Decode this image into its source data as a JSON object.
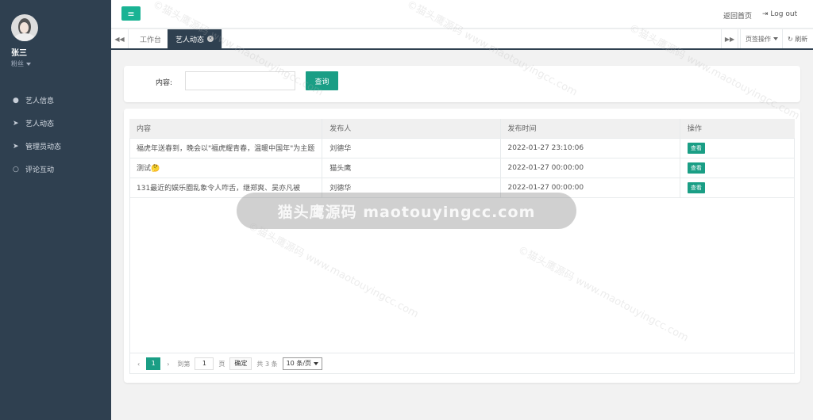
{
  "user": {
    "name": "张三",
    "role": "粉丝"
  },
  "nav": [
    {
      "label": "艺人信息",
      "icon": "user-circle-icon"
    },
    {
      "label": "艺人动态",
      "icon": "paper-plane-icon"
    },
    {
      "label": "管理员动态",
      "icon": "paper-plane-icon"
    },
    {
      "label": "评论互动",
      "icon": "comment-icon"
    }
  ],
  "header": {
    "home_link": "返回首页",
    "logout": "Log out"
  },
  "tabs": {
    "items": [
      {
        "label": "工作台"
      },
      {
        "label": "艺人动态"
      }
    ],
    "active": 1,
    "ops_label": "页签操作",
    "refresh_label": "刷新"
  },
  "search": {
    "label": "内容:",
    "value": "",
    "button": "查询"
  },
  "table": {
    "headers": [
      "内容",
      "发布人",
      "发布时间",
      "操作"
    ],
    "rows": [
      {
        "content": "福虎年送春到，晚会以\"福虎耀青春，温暖中国年\"为主题",
        "author": "刘德华",
        "time": "2022-01-27 23:10:06",
        "action": "查看"
      },
      {
        "content": "测试🤔",
        "author": "猫头鹰",
        "time": "2022-01-27 00:00:00",
        "action": "查看"
      },
      {
        "content": "131最近的娱乐圈乱象令人咋舌，继郑爽、吴亦凡被",
        "author": "刘德华",
        "time": "2022-01-27 00:00:00",
        "action": "查看"
      }
    ]
  },
  "pager": {
    "current": "1",
    "goto_prefix": "到第",
    "goto_value": "1",
    "goto_suffix": "页",
    "confirm": "确定",
    "total": "共 3 条",
    "page_size": "10 条/页"
  },
  "watermark": {
    "banner": "猫头鹰源码 maotouyingcc.com",
    "tile": "©猫头鹰源码 www.maotouyingcc.com"
  },
  "colors": {
    "sidebar": "#2f4050",
    "accent": "#1a9e85"
  }
}
